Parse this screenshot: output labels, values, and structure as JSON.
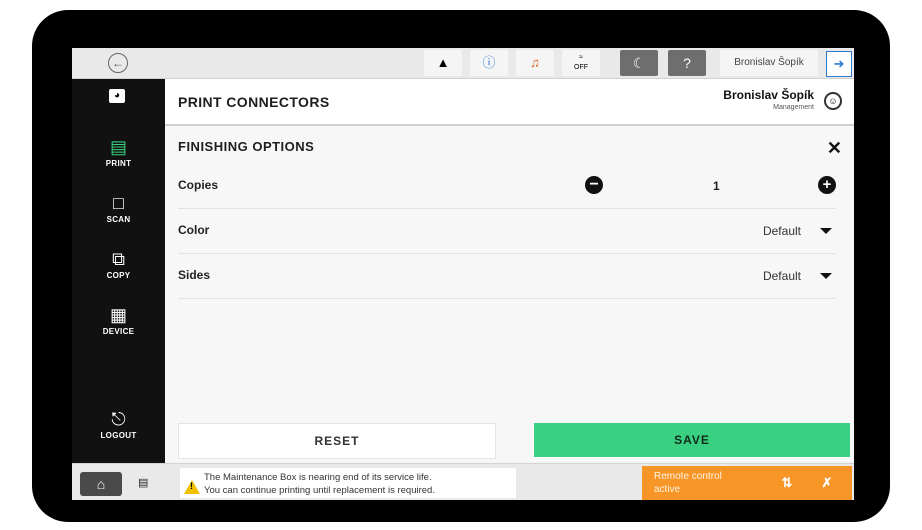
{
  "statusbar": {
    "back_icon": "back-arrow-icon",
    "icons": [
      "toner-warning-icon",
      "info-icon",
      "sound-mute-icon",
      "fax-off-icon"
    ],
    "fax_off_label": "OFF",
    "night_icon": "moon-icon",
    "help_icon": "help-icon",
    "user_label": "Bronislav Šopík",
    "logout_icon": "logout-icon"
  },
  "sidebar": {
    "items": [
      {
        "label": "PRINT",
        "icon": "print-icon",
        "color": "#3ad081"
      },
      {
        "label": "SCAN",
        "icon": "scan-icon"
      },
      {
        "label": "COPY",
        "icon": "copy-icon"
      },
      {
        "label": "DEVICE",
        "icon": "device-icon"
      }
    ],
    "logout_label": "LOGOUT"
  },
  "header": {
    "title": "PRINT CONNECTORS",
    "user_name": "Bronislav Šopík",
    "user_role": "Management"
  },
  "panel": {
    "section_title": "FINISHING OPTIONS",
    "copies": {
      "label": "Copies",
      "value": "1"
    },
    "color": {
      "label": "Color",
      "value": "Default"
    },
    "sides": {
      "label": "Sides",
      "value": "Default"
    }
  },
  "actions": {
    "reset_label": "RESET",
    "save_label": "SAVE",
    "save_color": "#3ad081"
  },
  "footer": {
    "warning_line1": "The Maintenance Box is nearing end of its service life.",
    "warning_line2": "You can continue printing until replacement is required.",
    "remote_line1": "Remote control",
    "remote_line2": "active",
    "remote_color": "#f79527"
  }
}
